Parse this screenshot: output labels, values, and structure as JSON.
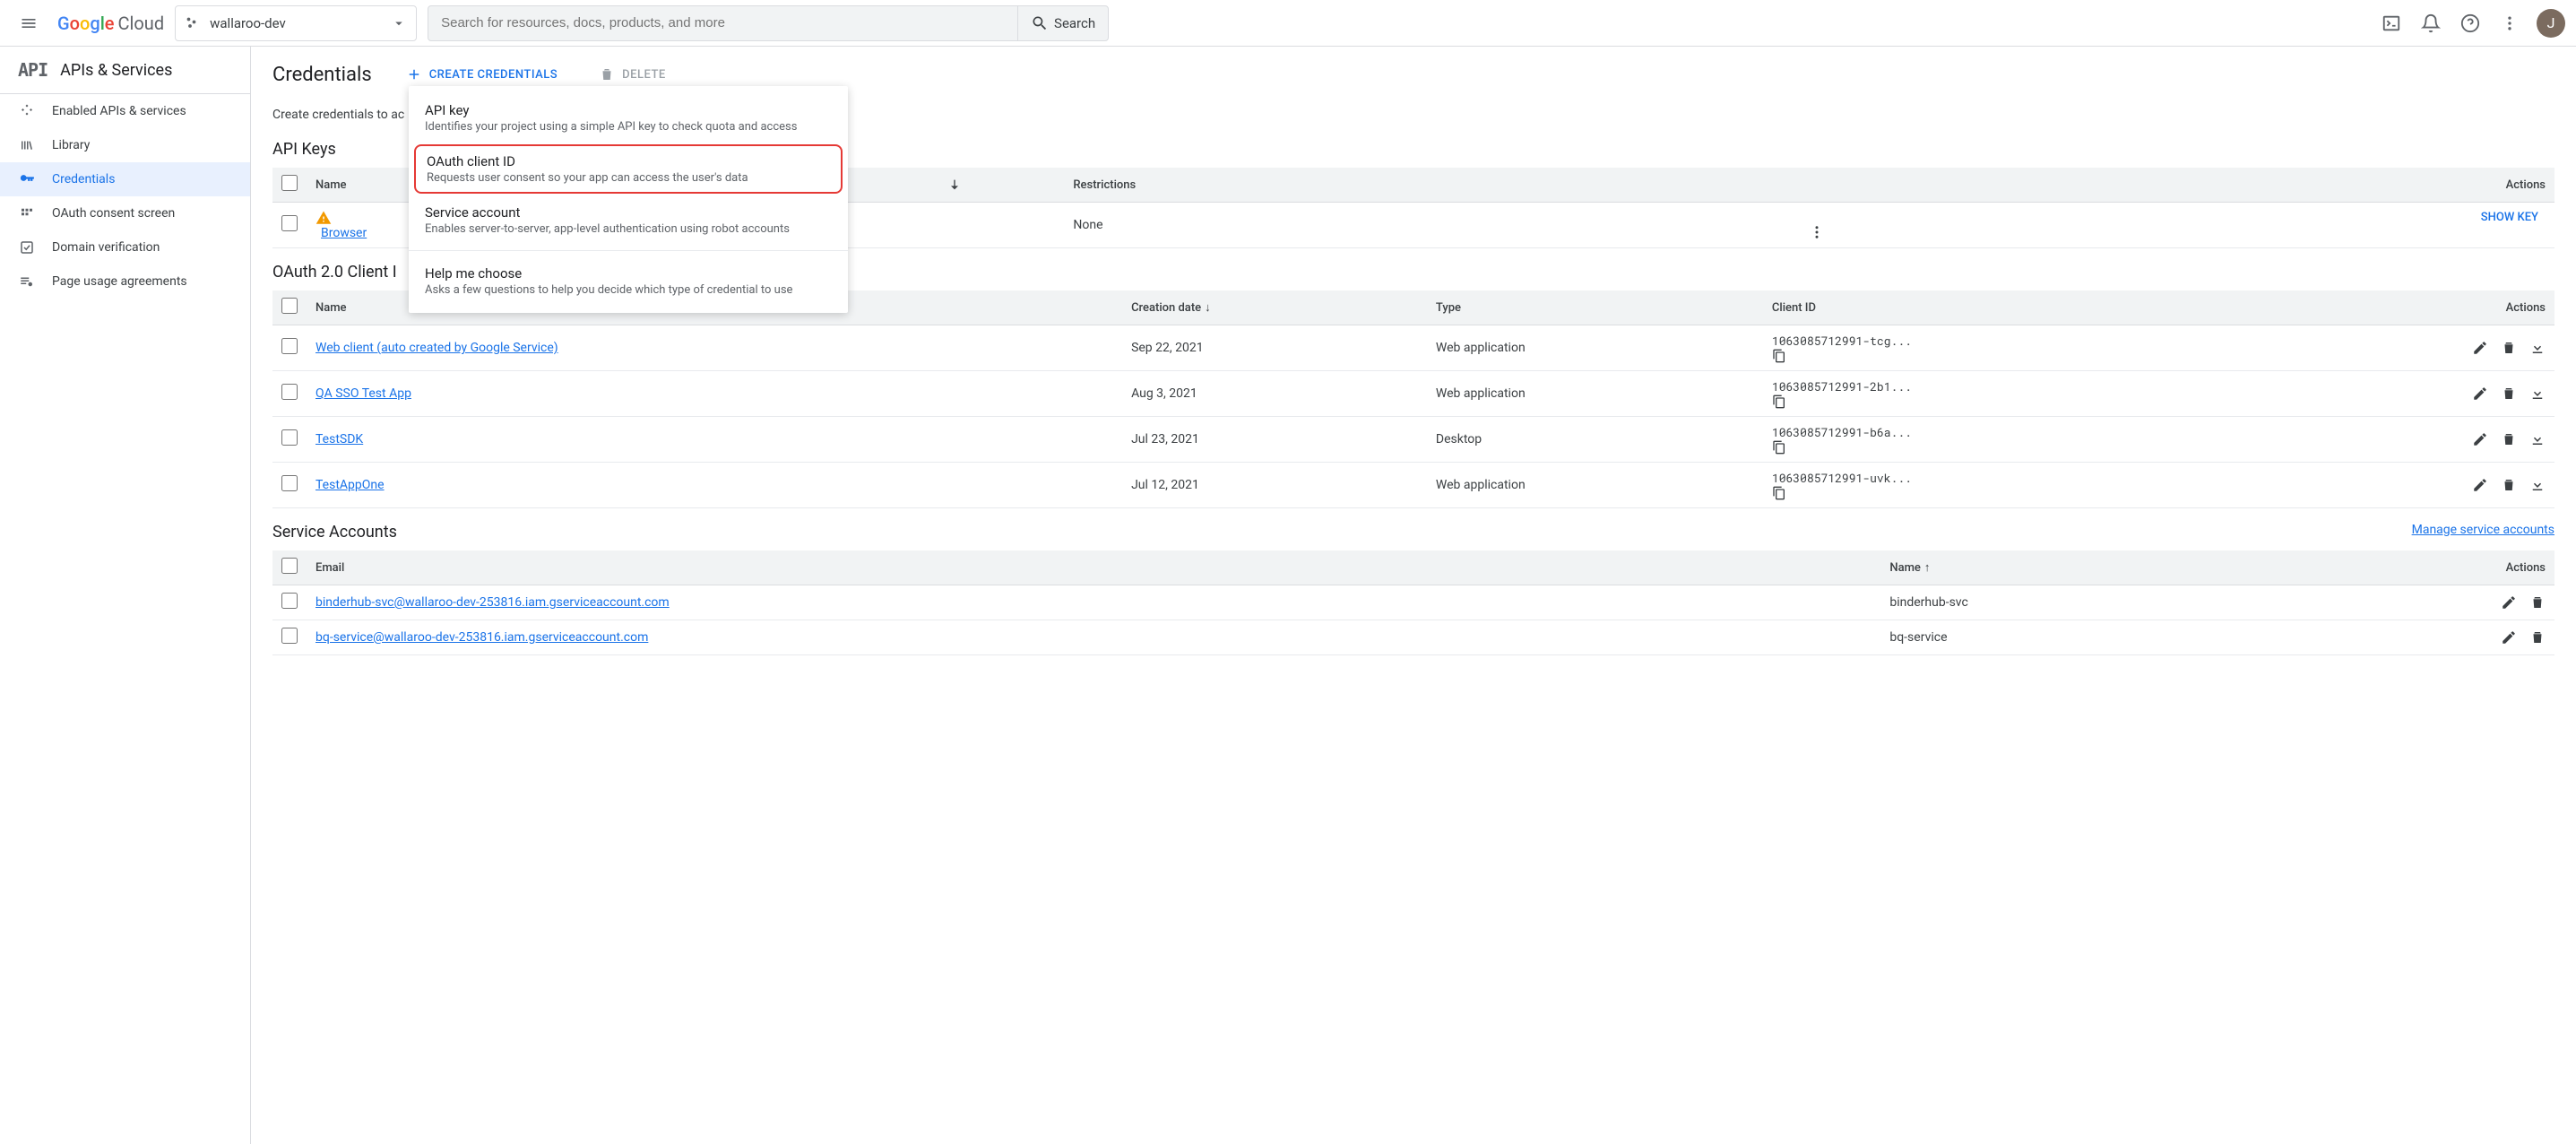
{
  "topbar": {
    "logo_cloud": "Cloud",
    "project_name": "wallaroo-dev",
    "search_placeholder": "Search for resources, docs, products, and more",
    "search_button": "Search",
    "avatar_initial": "J"
  },
  "sidebar": {
    "title": "APIs & Services",
    "items": [
      {
        "label": "Enabled APIs & services"
      },
      {
        "label": "Library"
      },
      {
        "label": "Credentials"
      },
      {
        "label": "OAuth consent screen"
      },
      {
        "label": "Domain verification"
      },
      {
        "label": "Page usage agreements"
      }
    ]
  },
  "page": {
    "title": "Credentials",
    "create_btn": "CREATE CREDENTIALS",
    "delete_btn": "DELETE",
    "subtitle": "Create credentials to ac"
  },
  "dropdown": {
    "items": [
      {
        "title": "API key",
        "desc": "Identifies your project using a simple API key to check quota and access"
      },
      {
        "title": "OAuth client ID",
        "desc": "Requests user consent so your app can access the user's data"
      },
      {
        "title": "Service account",
        "desc": "Enables server-to-server, app-level authentication using robot accounts"
      },
      {
        "title": "Help me choose",
        "desc": "Asks a few questions to help you decide which type of credential to use"
      }
    ]
  },
  "api_keys": {
    "section_title": "API Keys",
    "headers": {
      "name": "Name",
      "restrictions": "Restrictions",
      "actions": "Actions"
    },
    "rows": [
      {
        "name": "Browser",
        "restrictions": "None",
        "show_key": "SHOW KEY"
      }
    ]
  },
  "oauth": {
    "section_title": "OAuth 2.0 Client I",
    "headers": {
      "name": "Name",
      "creation": "Creation date",
      "type": "Type",
      "client_id": "Client ID",
      "actions": "Actions"
    },
    "rows": [
      {
        "name": "Web client (auto created by Google Service)",
        "date": "Sep 22, 2021",
        "type": "Web application",
        "id": "1063085712991-tcg..."
      },
      {
        "name": "QA SSO Test App",
        "date": "Aug 3, 2021",
        "type": "Web application",
        "id": "1063085712991-2b1..."
      },
      {
        "name": "TestSDK",
        "date": "Jul 23, 2021",
        "type": "Desktop",
        "id": "1063085712991-b6a..."
      },
      {
        "name": "TestAppOne",
        "date": "Jul 12, 2021",
        "type": "Web application",
        "id": "1063085712991-uvk..."
      }
    ]
  },
  "service_accounts": {
    "section_title": "Service Accounts",
    "manage_link": "Manage service accounts",
    "headers": {
      "email": "Email",
      "name": "Name",
      "actions": "Actions"
    },
    "rows": [
      {
        "email": "binderhub-svc@wallaroo-dev-253816.iam.gserviceaccount.com",
        "name": "binderhub-svc"
      },
      {
        "email": "bq-service@wallaroo-dev-253816.iam.gserviceaccount.com",
        "name": "bq-service"
      }
    ]
  }
}
